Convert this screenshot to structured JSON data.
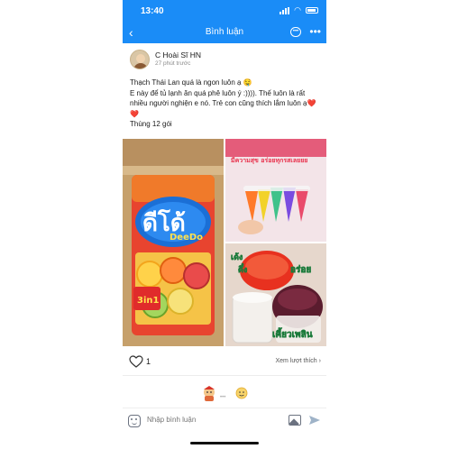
{
  "status_bar": {
    "time": "13:40"
  },
  "nav": {
    "title": "Bình luận",
    "back_icon": "chevron-left-icon",
    "chat_icon": "chat-bubble-icon",
    "more_icon": "more-dots-icon",
    "color": "#1a8cf7"
  },
  "post": {
    "author": "C Hoài Sĩ HN",
    "time_ago": "27 phút trước",
    "lines": [
      "Thạch Thái Lan quá là ngon luôn ạ 🤤",
      "E này để tủ lạnh ăn quá phê luôn ý :)))). Thế luôn là rất nhiều người nghiện e nó. Trẻ con cũng thích lắm luôn ạ❤️❤️",
      "Thùng 12 gói"
    ],
    "images": {
      "main": {
        "brand": "ดีโด้",
        "brand_latin": "DeeDo",
        "badge": "3in1"
      },
      "top": {
        "caption": "มีความสุข อร่อยทุกรสเลยยย"
      },
      "bottom": {
        "caption_a": "เด้ง",
        "caption_b": "ดึ๋ง",
        "caption_c": "อร่อย",
        "caption_d": "เคี้ยวเพลิน"
      }
    }
  },
  "actions": {
    "like_count": "1",
    "see_likes": "Xem lượt thích",
    "heart_icon": "heart-outline-icon"
  },
  "reactions": {
    "dots": "•••"
  },
  "compose": {
    "placeholder": "Nhập bình luận",
    "sticker_icon": "sticker-icon",
    "image_icon": "image-icon",
    "send_icon": "send-icon"
  }
}
